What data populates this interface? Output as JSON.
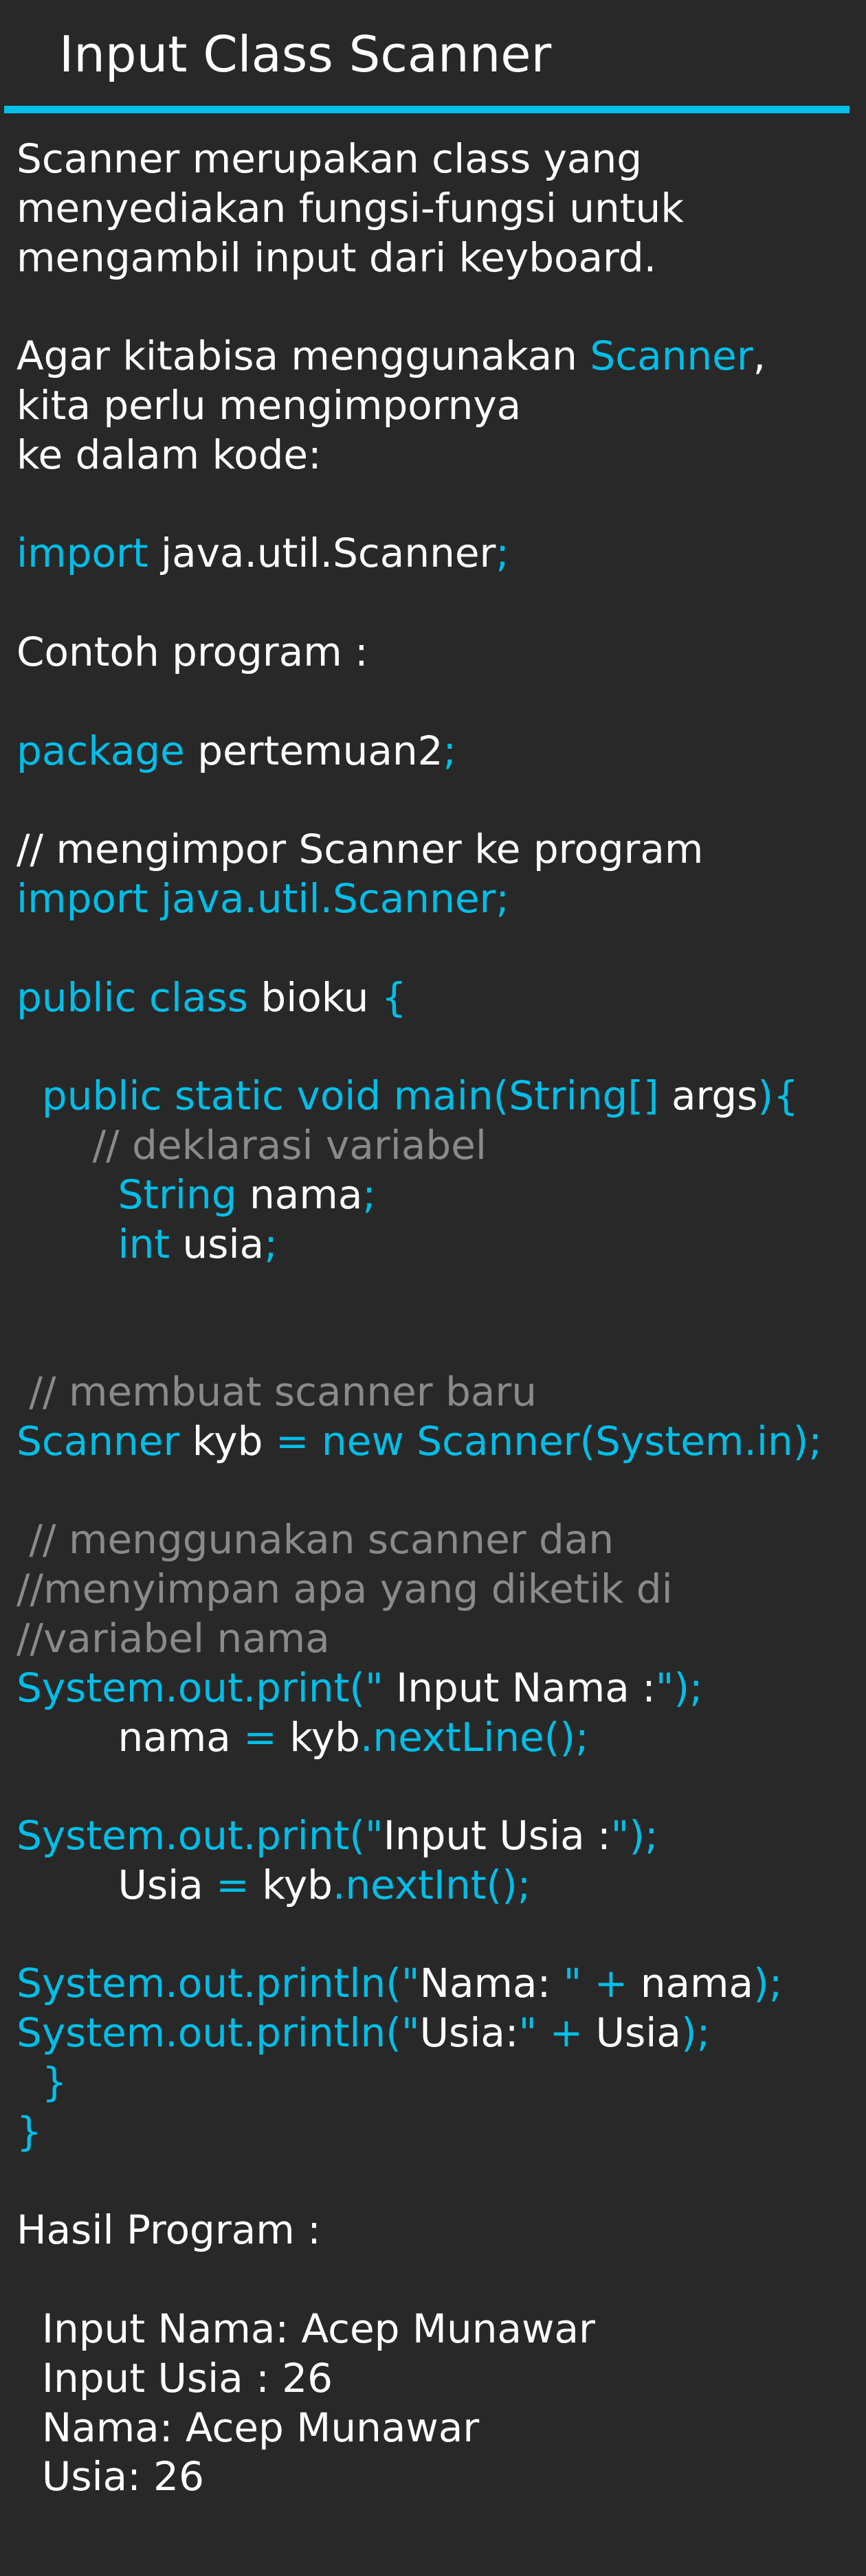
{
  "title": "Input Class Scanner",
  "colors": {
    "background": "#282828",
    "accent": "#00bfe8",
    "text": "#ffffff",
    "comment": "#8a8a8a"
  },
  "lines": [
    {
      "text": "Scanner merupakan class yang"
    },
    {
      "text": "menyediakan fungsi-fungsi untuk"
    },
    {
      "text": "mengambil input dari keyboard."
    },
    {
      "text": ""
    },
    {
      "segments": [
        {
          "text": "Agar kitabisa menggunakan ",
          "color": "w"
        },
        {
          "text": "Scanner",
          "color": "c"
        },
        {
          "text": ",",
          "color": "w"
        }
      ]
    },
    {
      "text": "kita perlu mengimpornya"
    },
    {
      "text": "ke dalam kode:"
    },
    {
      "text": ""
    },
    {
      "segments": [
        {
          "text": "import",
          "color": "c"
        },
        {
          "text": " java.util.Scanner",
          "color": "w"
        },
        {
          "text": ";",
          "color": "c"
        }
      ]
    },
    {
      "text": ""
    },
    {
      "text": "Contoh program :"
    },
    {
      "text": ""
    },
    {
      "segments": [
        {
          "text": "package",
          "color": "c"
        },
        {
          "text": " pertemuan2",
          "color": "w"
        },
        {
          "text": ";",
          "color": "c"
        }
      ]
    },
    {
      "text": ""
    },
    {
      "text": "// mengimpor Scanner ke program"
    },
    {
      "segments": [
        {
          "text": "import java.util.Scanner;",
          "color": "c"
        }
      ]
    },
    {
      "text": ""
    },
    {
      "segments": [
        {
          "text": "public class",
          "color": "c"
        },
        {
          "text": " bioku ",
          "color": "w"
        },
        {
          "text": "{",
          "color": "c"
        }
      ]
    },
    {
      "text": ""
    },
    {
      "segments": [
        {
          "text": "  public static void main(String[]",
          "color": "c"
        },
        {
          "text": " args",
          "color": "w"
        },
        {
          "text": "){",
          "color": "c"
        }
      ]
    },
    {
      "segments": [
        {
          "text": "      // deklarasi variabel",
          "color": "g"
        }
      ]
    },
    {
      "segments": [
        {
          "text": "        String",
          "color": "c"
        },
        {
          "text": " nama",
          "color": "w"
        },
        {
          "text": ";",
          "color": "c"
        }
      ]
    },
    {
      "segments": [
        {
          "text": "        int",
          "color": "c"
        },
        {
          "text": " usia",
          "color": "w"
        },
        {
          "text": ";",
          "color": "c"
        }
      ]
    },
    {
      "text": ""
    },
    {
      "text": ""
    },
    {
      "segments": [
        {
          "text": " // membuat scanner baru",
          "color": "g"
        }
      ]
    },
    {
      "segments": [
        {
          "text": "Scanner",
          "color": "c"
        },
        {
          "text": " kyb ",
          "color": "w"
        },
        {
          "text": "= new Scanner(System.in);",
          "color": "c"
        }
      ]
    },
    {
      "text": ""
    },
    {
      "segments": [
        {
          "text": " // menggunakan scanner dan",
          "color": "g"
        }
      ]
    },
    {
      "segments": [
        {
          "text": "//menyimpan apa yang diketik di",
          "color": "g"
        }
      ]
    },
    {
      "segments": [
        {
          "text": "//variabel nama",
          "color": "g"
        }
      ]
    },
    {
      "segments": [
        {
          "text": "System.out.print(\"",
          "color": "c"
        },
        {
          "text": " Input Nama :",
          "color": "w"
        },
        {
          "text": "\");",
          "color": "c"
        }
      ]
    },
    {
      "segments": [
        {
          "text": "        nama ",
          "color": "w"
        },
        {
          "text": "=",
          "color": "c"
        },
        {
          "text": " kyb",
          "color": "w"
        },
        {
          "text": ".nextLine();",
          "color": "c"
        }
      ]
    },
    {
      "text": ""
    },
    {
      "segments": [
        {
          "text": "System.out.print(\"",
          "color": "c"
        },
        {
          "text": "Input Usia :",
          "color": "w"
        },
        {
          "text": "\");",
          "color": "c"
        }
      ]
    },
    {
      "segments": [
        {
          "text": "        Usia ",
          "color": "w"
        },
        {
          "text": "=",
          "color": "c"
        },
        {
          "text": " kyb",
          "color": "w"
        },
        {
          "text": ".nextInt();",
          "color": "c"
        }
      ]
    },
    {
      "text": ""
    },
    {
      "segments": [
        {
          "text": "System.out.println(\"",
          "color": "c"
        },
        {
          "text": "Nama: ",
          "color": "w"
        },
        {
          "text": "\" + ",
          "color": "c"
        },
        {
          "text": "nama",
          "color": "w"
        },
        {
          "text": ");",
          "color": "c"
        }
      ]
    },
    {
      "segments": [
        {
          "text": "System.out.println(\"",
          "color": "c"
        },
        {
          "text": "Usia:",
          "color": "w"
        },
        {
          "text": "\" + ",
          "color": "c"
        },
        {
          "text": "Usia",
          "color": "w"
        },
        {
          "text": ");",
          "color": "c"
        }
      ]
    },
    {
      "segments": [
        {
          "text": "  }",
          "color": "c"
        }
      ]
    },
    {
      "segments": [
        {
          "text": "}",
          "color": "c"
        }
      ]
    },
    {
      "text": ""
    },
    {
      "text": "Hasil Program :"
    },
    {
      "text": ""
    },
    {
      "text": "  Input Nama: Acep Munawar"
    },
    {
      "text": "  Input Usia : 26"
    },
    {
      "text": "  Nama: Acep Munawar"
    },
    {
      "text": "  Usia: 26"
    }
  ]
}
